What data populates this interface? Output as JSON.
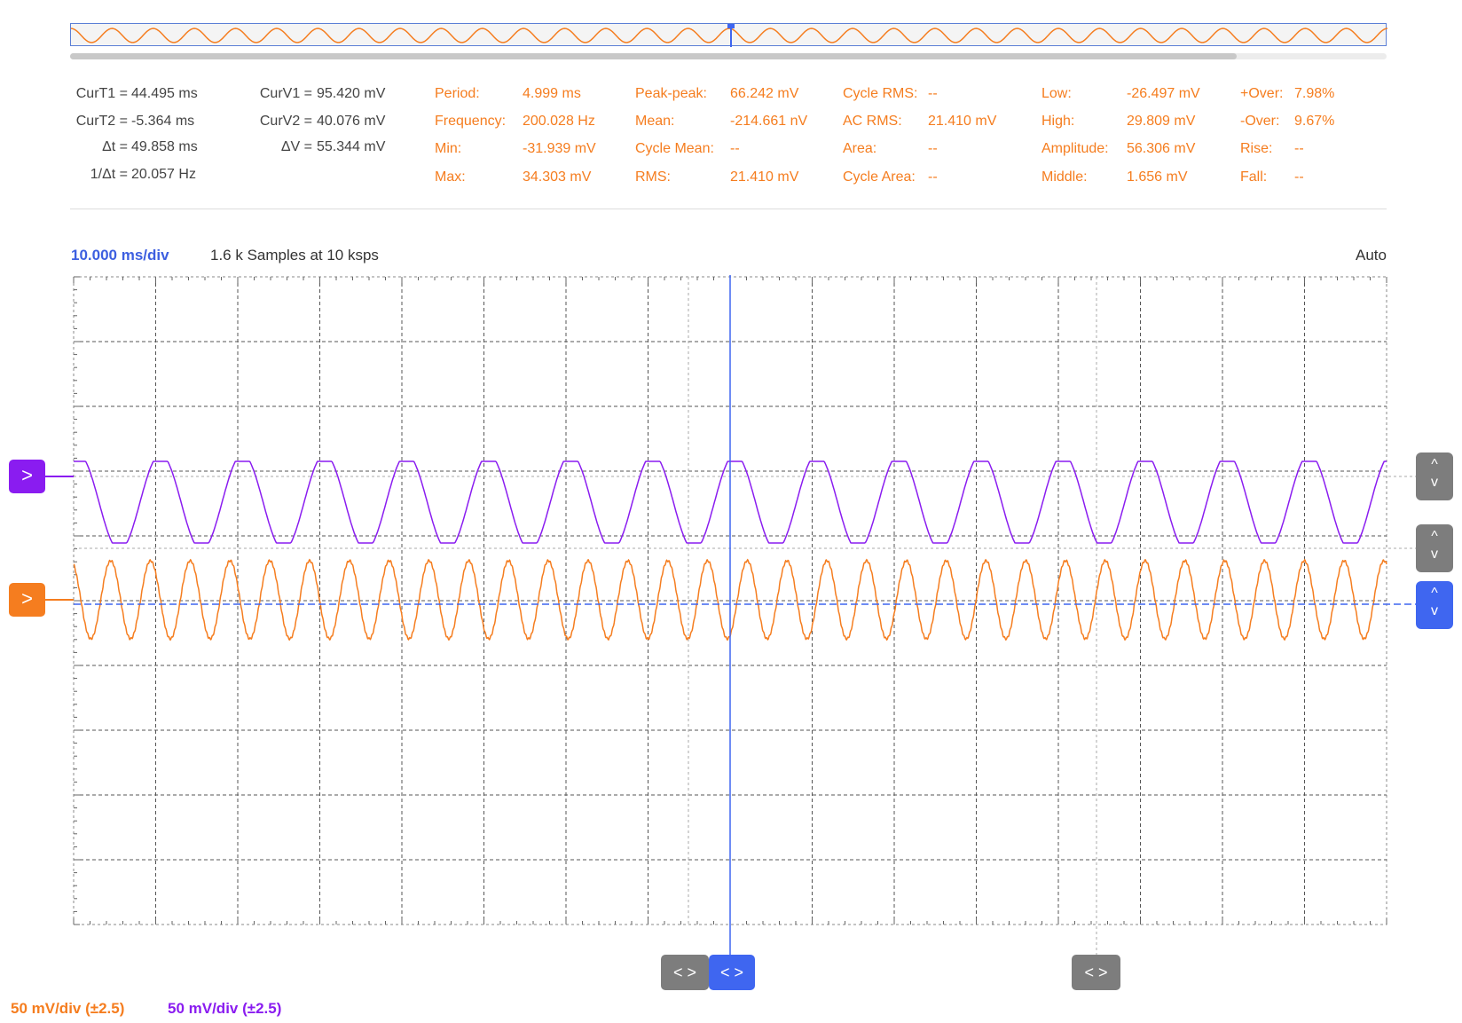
{
  "colors": {
    "channel1": "#f57d1f",
    "channel2": "#8a1cf0",
    "cursor": "#3f66f0",
    "grid": "#555555",
    "button_gray": "#7d7d7d"
  },
  "cursors": {
    "curT1_label": "CurT1 =",
    "curT1_value": "44.495 ms",
    "curT2_label": "CurT2 =",
    "curT2_value": "-5.364 ms",
    "dt_label": "Δt =",
    "dt_value": "49.858 ms",
    "inv_dt_label": "1/Δt =",
    "inv_dt_value": "20.057 Hz",
    "curV1_label": "CurV1 =",
    "curV1_value": "95.420 mV",
    "curV2_label": "CurV2 =",
    "curV2_value": "40.076 mV",
    "dv_label": "ΔV =",
    "dv_value": "55.344 mV"
  },
  "measurements": {
    "period_label": "Period:",
    "period_value": "4.999 ms",
    "frequency_label": "Frequency:",
    "frequency_value": "200.028 Hz",
    "min_label": "Min:",
    "min_value": "-31.939 mV",
    "max_label": "Max:",
    "max_value": "34.303 mV",
    "peakpeak_label": "Peak-peak:",
    "peakpeak_value": "66.242 mV",
    "mean_label": "Mean:",
    "mean_value": "-214.661 nV",
    "cyclemean_label": "Cycle Mean:",
    "cyclemean_value": "--",
    "rms_label": "RMS:",
    "rms_value": "21.410 mV",
    "cyclerms_label": "Cycle RMS:",
    "cyclerms_value": "--",
    "acrms_label": "AC RMS:",
    "acrms_value": "21.410 mV",
    "area_label": "Area:",
    "area_value": "--",
    "cyclearea_label": "Cycle Area:",
    "cyclearea_value": "--",
    "low_label": "Low:",
    "low_value": "-26.497 mV",
    "high_label": "High:",
    "high_value": "29.809 mV",
    "amplitude_label": "Amplitude:",
    "amplitude_value": "56.306 mV",
    "middle_label": "Middle:",
    "middle_value": "1.656 mV",
    "over_pos_label": "+Over:",
    "over_pos_value": "7.98%",
    "over_neg_label": "-Over:",
    "over_neg_value": "9.67%",
    "rise_label": "Rise:",
    "rise_value": "--",
    "fall_label": "Fall:",
    "fall_value": "--"
  },
  "plot": {
    "timebase": "10.000 ms/div",
    "samples": "1.6 k Samples at 10 ksps",
    "trigger_mode": "Auto",
    "ch1_scale": "50 mV/div (±2.5)",
    "ch2_scale": "50 mV/div (±2.5)",
    "ch1_cycles": 33,
    "ch2_cycles": 16
  },
  "icons": {
    "channel_marker": ">",
    "up": "^",
    "down": "v",
    "cursor_pair": "< >"
  }
}
